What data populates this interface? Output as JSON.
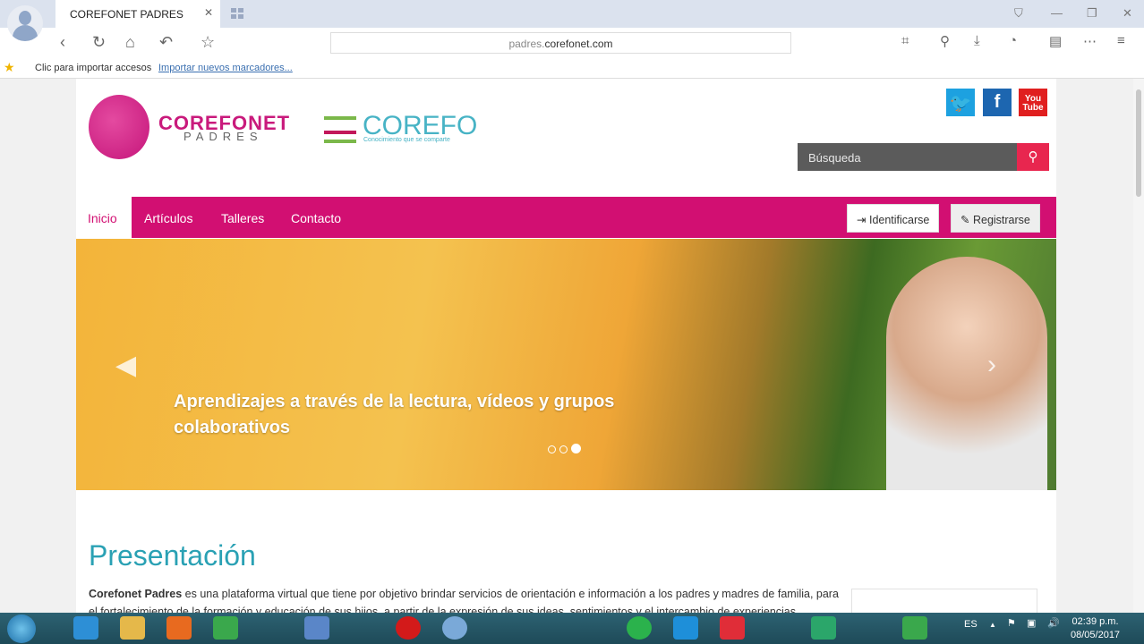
{
  "browser": {
    "tab_title": "COREFONET PADRES",
    "url_sub": "padres.",
    "url_domain": "corefonet.com",
    "bookmarks_hint": "Clic para importar accesos",
    "bookmarks_link": "Importar nuevos marcadores..."
  },
  "site": {
    "logo_title": "COREFONET",
    "logo_sub": "PADRES",
    "partner_title": "COREFO",
    "partner_tagline": "Conocimiento que se comparte",
    "social": [
      {
        "name": "twitter",
        "color": "#1da1e0"
      },
      {
        "name": "facebook",
        "color": "#1d66b0"
      },
      {
        "name": "youtube",
        "color": "#e01f1f"
      }
    ],
    "search_placeholder": "Búsqueda",
    "nav": [
      "Inicio",
      "Artículos",
      "Talleres",
      "Contacto"
    ],
    "login": "Identificarse",
    "register": "Registrarse",
    "slide_caption": "Aprendizajes a través de la lectura, vídeos y grupos colaborativos",
    "slide_count": 3,
    "slide_active": 3,
    "section_title": "Presentación",
    "intro_bold": "Corefonet Padres",
    "intro_text": " es una plataforma virtual que tiene por objetivo brindar servicios de orientación e información a los padres y madres de familia, para el fortalecimiento de la formación y educación de sus hijos, a partir de la expresión de sus ideas, sentimientos y el intercambio de experiencias"
  },
  "taskbar": {
    "lang": "ES",
    "time": "02:39 p.m.",
    "date": "08/05/2017"
  },
  "colors": {
    "brand": "#d20f72",
    "accent": "#2aa1b4"
  }
}
